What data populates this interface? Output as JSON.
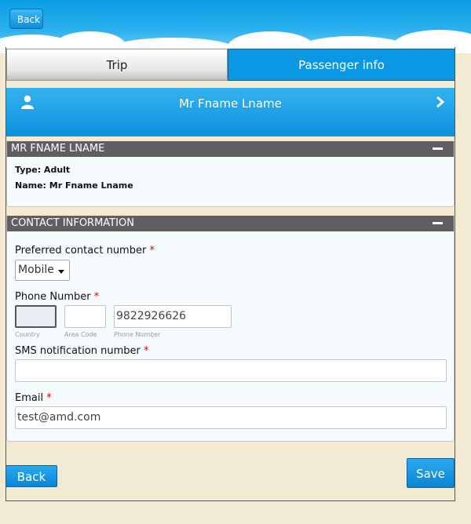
{
  "header": {
    "back_label": "Back"
  },
  "tabs": [
    {
      "label": "Trip",
      "active": false
    },
    {
      "label": "Passenger info",
      "active": true
    }
  ],
  "passenger_bar": {
    "name": "Mr Fname Lname",
    "icon": "user-icon",
    "nav_icon": "chevron-right-icon"
  },
  "passenger_panel": {
    "title": "MR FNAME LNAME",
    "type_line": "Type: Adult",
    "name_line": "Name: Mr Fname Lname"
  },
  "contact_panel": {
    "title": "CONTACT INFORMATION",
    "preferred_label": "Preferred contact number",
    "preferred_value": "Mobile",
    "phone_label": "Phone Number",
    "country_value": "",
    "country_sub": "Country",
    "area_value": "",
    "area_sub": "Area Code",
    "phone_value": "9822926626",
    "phone_sub": "Phone Number",
    "sms_label": "SMS notification number",
    "sms_value": "",
    "email_label": "Email",
    "email_value": "test@amd.com",
    "required_mark": "*"
  },
  "footer": {
    "back_label": "Back",
    "save_label": "Save"
  },
  "colors": {
    "accent": "#0a98e4",
    "panel_head": "#5f5f5f",
    "background": "#f3ead3"
  }
}
